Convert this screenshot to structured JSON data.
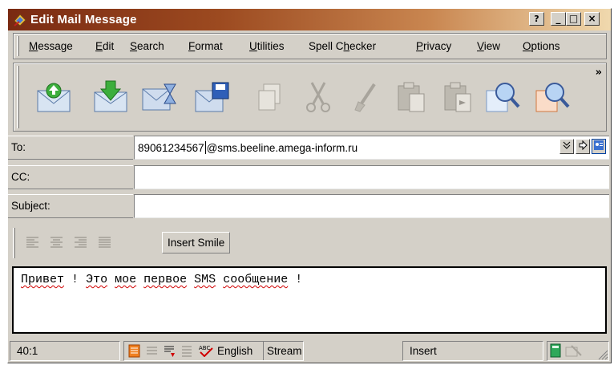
{
  "window": {
    "title": "Edit Mail Message",
    "controls": {
      "help": "?",
      "minimize": "_",
      "maximize": "□",
      "close": "×"
    }
  },
  "menu": [
    {
      "label": "Message",
      "mnemonic": "M"
    },
    {
      "label": "Edit",
      "mnemonic": "E"
    },
    {
      "label": "Search",
      "mnemonic": "S"
    },
    {
      "label": "Format",
      "mnemonic": "F"
    },
    {
      "label": "Utilities",
      "mnemonic": "U"
    },
    {
      "label": "Spell Checker",
      "mnemonic": "h"
    },
    {
      "label": "Privacy",
      "mnemonic": "P"
    },
    {
      "label": "View",
      "mnemonic": "V"
    },
    {
      "label": "Options",
      "mnemonic": "O"
    }
  ],
  "toolbar": {
    "chevron": "»",
    "icons": [
      "send-mail-icon",
      "receive-mail-icon",
      "send-later-icon",
      "save-draft-icon",
      "copy-icon",
      "cut-icon",
      "paste-icon",
      "paste-special-icon",
      "find-icon",
      "find-next-icon"
    ]
  },
  "fields": {
    "to_label": "To:",
    "to_value_before_caret": "89061234567",
    "to_value_after_caret": "@sms.beeline.amega-inform.ru",
    "cc_label": "CC:",
    "cc_value": "",
    "subject_label": "Subject:",
    "subject_value": ""
  },
  "format": {
    "insert_smile": "Insert Smile"
  },
  "editor": {
    "words": [
      "Привет",
      "!",
      "Это",
      "мое",
      "первое",
      "SMS",
      "сообщение",
      "!"
    ]
  },
  "status": {
    "position": "40:1",
    "language": "English",
    "mode": "Stream",
    "insert": "Insert"
  },
  "colors": {
    "titlebar_start": "#7a2a12",
    "titlebar_end": "#f0d9ae",
    "face": "#d4d0c8",
    "spell_error": "#d00000"
  }
}
